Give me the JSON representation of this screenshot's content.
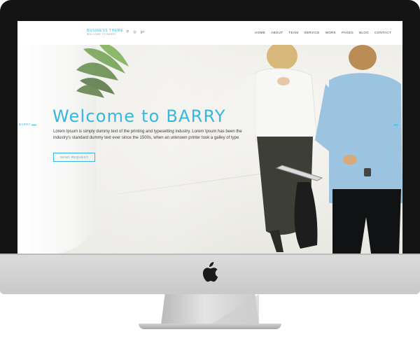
{
  "site": {
    "logo_title": "BUSINESS THEME",
    "logo_subtitle": "WELCOME TO BARRY",
    "social_icons": [
      "pinterest-icon",
      "dribbble-icon",
      "google-plus-icon"
    ],
    "social_glyphs": [
      "P",
      "◎",
      "g+"
    ],
    "nav": [
      "HOME",
      "ABOUT",
      "TEAM",
      "SERVICE",
      "WORK",
      "PAGES",
      "BLOG",
      "CONTACT"
    ]
  },
  "hero": {
    "title": "Welcome to BARRY",
    "body": "Lorem Ipsum is simply dummy text of the printing and typesetting industry. Lorem Ipsum has been the industry's standard dummy text ever since the 1500s, when an unknown printer took a galley of type",
    "button": "SEND REQUEST",
    "prev_label": "BARRY"
  },
  "colors": {
    "accent": "#35b8de",
    "bezel": "#141414",
    "chin": "#d6d6d6"
  }
}
